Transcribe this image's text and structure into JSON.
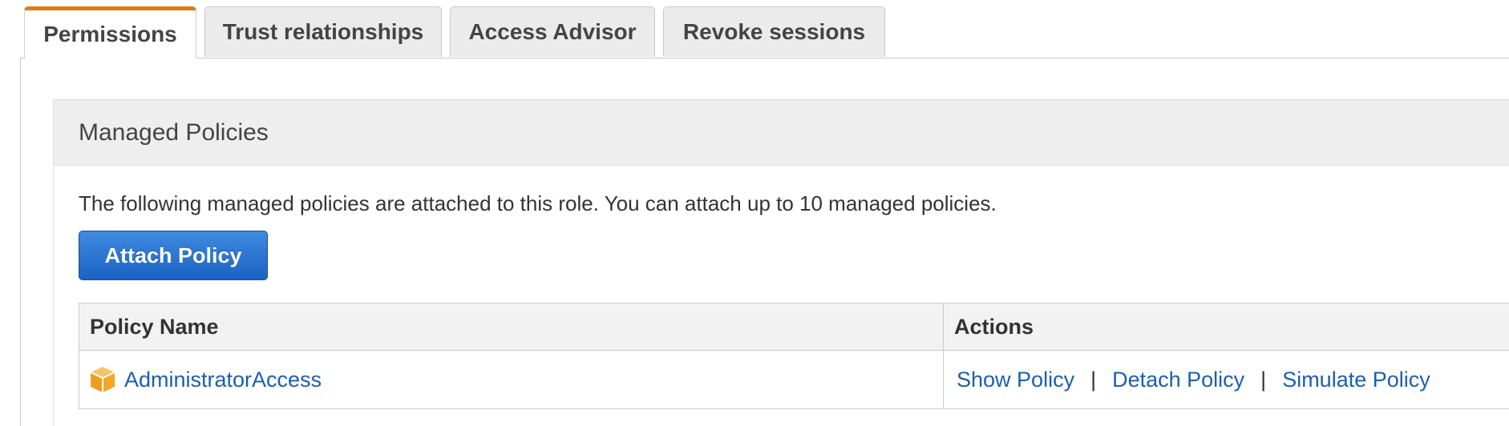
{
  "tabs": [
    {
      "label": "Permissions",
      "active": true
    },
    {
      "label": "Trust relationships",
      "active": false
    },
    {
      "label": "Access Advisor",
      "active": false
    },
    {
      "label": "Revoke sessions",
      "active": false
    }
  ],
  "managed_policies": {
    "title": "Managed Policies",
    "description": "The following managed policies are attached to this role. You can attach up to 10 managed policies.",
    "attach_button_label": "Attach Policy",
    "table": {
      "headers": {
        "policy_name": "Policy Name",
        "actions": "Actions"
      },
      "rows": [
        {
          "policy_name": "AdministratorAccess",
          "icon": "aws-managed-policy-cube-icon",
          "actions": {
            "show": "Show Policy",
            "detach": "Detach Policy",
            "simulate": "Simulate Policy",
            "separator": "|"
          }
        }
      ]
    }
  },
  "colors": {
    "active_tab_accent": "#e07b13",
    "primary_button": "#1b63c4",
    "link": "#1b5fb0",
    "policy_icon": "#f5a623"
  }
}
